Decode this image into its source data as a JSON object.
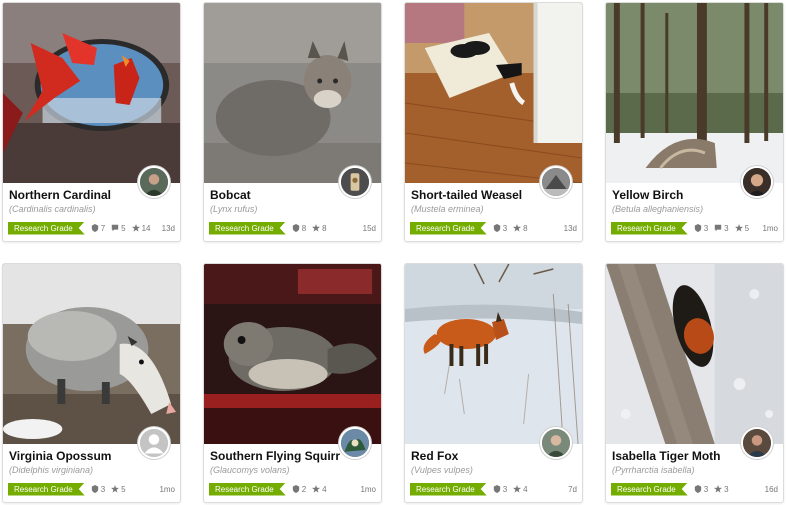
{
  "cards": [
    {
      "name": "Northern Cardinal",
      "sci": "Cardinalis cardinalis",
      "badge": "Research Grade",
      "ids": "7",
      "comments": "5",
      "faves": "14",
      "age": "13d"
    },
    {
      "name": "Bobcat",
      "sci": "Lynx rufus",
      "badge": "Research Grade",
      "ids": "8",
      "faves": "8",
      "age": "15d"
    },
    {
      "name": "Short-tailed Weasel",
      "sci": "Mustela erminea",
      "badge": "Research Grade",
      "ids": "3",
      "faves": "8",
      "age": "13d"
    },
    {
      "name": "Yellow Birch",
      "sci": "Betula alleghaniensis",
      "badge": "Research Grade",
      "ids": "3",
      "comments": "3",
      "faves": "5",
      "age": "1mo"
    },
    {
      "name": "Virginia Opossum",
      "sci": "Didelphis virginiana",
      "badge": "Research Grade",
      "ids": "3",
      "faves": "5",
      "age": "1mo"
    },
    {
      "name": "Southern Flying Squirrel",
      "sci": "Glaucomys volans",
      "badge": "Research Grade",
      "ids": "2",
      "faves": "4",
      "age": "1mo"
    },
    {
      "name": "Red Fox",
      "sci": "Vulpes vulpes",
      "badge": "Research Grade",
      "ids": "3",
      "faves": "4",
      "age": "7d"
    },
    {
      "name": "Isabella Tiger Moth",
      "sci": "Pyrrharctia isabella",
      "badge": "Research Grade",
      "ids": "3",
      "faves": "3",
      "age": "16d"
    }
  ],
  "colors": {
    "badge": "#74ac00",
    "meta_text": "#777777",
    "sci_text": "#9a9a9a"
  },
  "icons": {
    "ids": "shield-icon",
    "comments": "comment-icon",
    "faves": "star-icon"
  }
}
